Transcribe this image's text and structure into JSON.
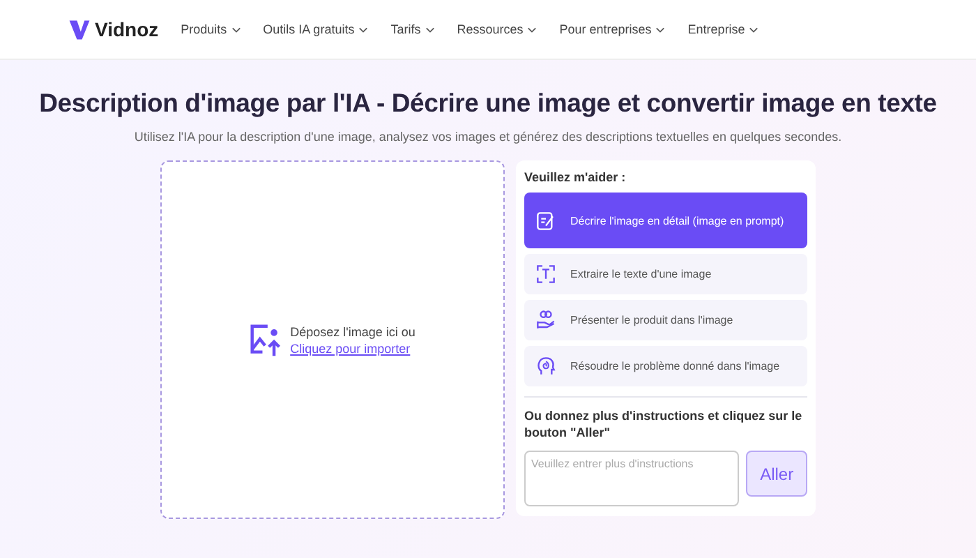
{
  "nav": {
    "brand": "Vidnoz",
    "items": [
      {
        "label": "Produits"
      },
      {
        "label": "Outils IA gratuits"
      },
      {
        "label": "Tarifs"
      },
      {
        "label": "Ressources"
      },
      {
        "label": "Pour entreprises"
      },
      {
        "label": "Entreprise"
      }
    ]
  },
  "title": "Description d'image par l'IA - Décrire une image et convertir image en texte",
  "subtitle": "Utilisez l'IA pour la description d'une image, analysez vos images et générez des descriptions textuelles en quelques secondes.",
  "upload": {
    "text": "Déposez l'image ici ou",
    "link": "Cliquez pour importer"
  },
  "panel": {
    "heading": "Veuillez m'aider :",
    "options": [
      {
        "kind": "describe",
        "label": "Décrire l'image en détail (image en prompt)",
        "selected": true
      },
      {
        "kind": "text",
        "label": "Extraire le texte d'une image",
        "selected": false
      },
      {
        "kind": "product",
        "label": "Présenter le produit dans l'image",
        "selected": false
      },
      {
        "kind": "problem",
        "label": "Résoudre le problème donné dans l'image",
        "selected": false
      }
    ],
    "instructions_label": "Ou donnez plus d'instructions et cliquez sur le bouton \"Aller\"",
    "input": {
      "placeholder": "Veuillez entrer plus d'instructions"
    },
    "button": "Aller"
  }
}
